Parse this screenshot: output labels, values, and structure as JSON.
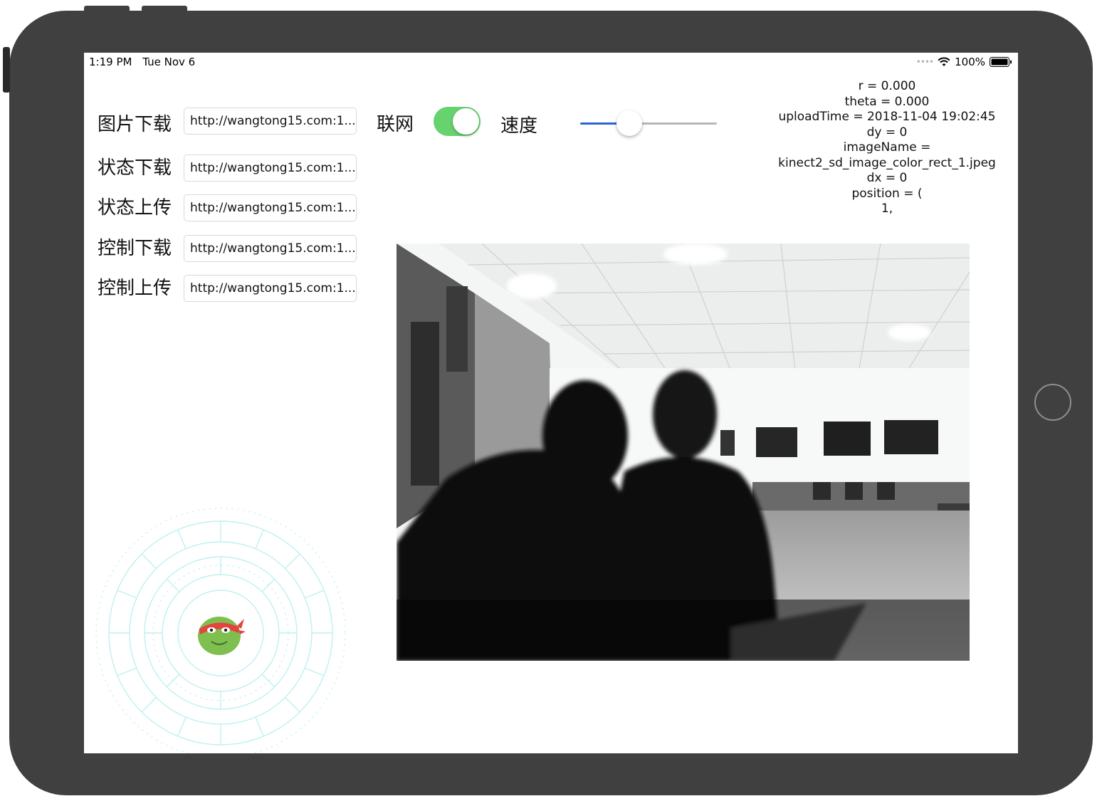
{
  "status_bar": {
    "time": "1:19 PM",
    "date": "Tue Nov 6",
    "battery": "100%",
    "icons": [
      "signal-dots-icon",
      "wifi-icon",
      "battery-icon"
    ]
  },
  "url_settings": [
    {
      "label": "图片下载",
      "value": "http://wangtong15.com:1..."
    },
    {
      "label": "状态下载",
      "value": "http://wangtong15.com:1..."
    },
    {
      "label": "状态上传",
      "value": "http://wangtong15.com:1..."
    },
    {
      "label": "控制下载",
      "value": "http://wangtong15.com:1..."
    },
    {
      "label": "控制上传",
      "value": "http://wangtong15.com:1..."
    }
  ],
  "network": {
    "label": "联网",
    "enabled": true
  },
  "speed": {
    "label": "速度",
    "value": 0.33
  },
  "info_lines": [
    "r = 0.000",
    "theta = 0.000",
    "uploadTime = 2018-11-04 19:02:45",
    "dy = 0",
    "imageName =",
    "kinect2_sd_image_color_rect_1.jpeg",
    "dx = 0",
    "position = (",
    "1,"
  ],
  "colors": {
    "device_frame": "#404040",
    "toggle_on": "#66d36e",
    "slider_fill": "#2a64d8",
    "joystick_rings": "#bff0f0"
  }
}
